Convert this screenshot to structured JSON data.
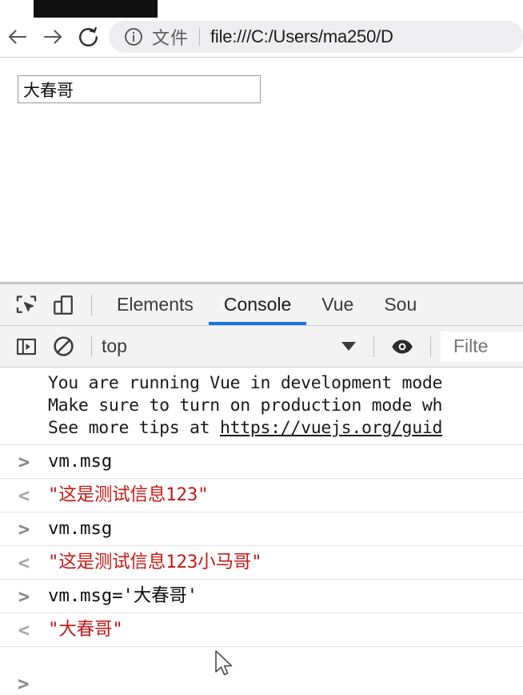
{
  "browser": {
    "nav": {
      "back_label": "Back",
      "forward_label": "Forward",
      "reload_label": "Reload"
    },
    "omnibox": {
      "site_info_icon": "info-circle-icon",
      "scheme_label": "文件",
      "url": "file:///C:/Users/ma250/D"
    }
  },
  "page": {
    "input_value": "大春哥",
    "input_placeholder": ""
  },
  "devtools": {
    "icons": {
      "inspect": "inspect-element-icon",
      "device": "device-toolbar-icon"
    },
    "tabs": [
      {
        "label": "Elements",
        "active": false
      },
      {
        "label": "Console",
        "active": true
      },
      {
        "label": "Vue",
        "active": false
      },
      {
        "label": "Sou",
        "active": false
      }
    ],
    "console_toolbar": {
      "sidebar_icon": "console-sidebar-icon",
      "clear_icon": "clear-console-icon",
      "context": "top",
      "caret_icon": "chevron-down-icon",
      "eye_icon": "live-expression-eye-icon",
      "filter_placeholder": "Filte"
    },
    "messages": {
      "vue_warning": [
        "You are running Vue in development mode",
        "Make sure to turn on production mode wh",
        "See more tips at "
      ],
      "vue_warning_link": "https://vuejs.org/guid"
    },
    "entries": [
      {
        "input_arrow": ">",
        "input": "vm.msg",
        "output_arrow": "<",
        "output": "\"这是测试信息123\""
      },
      {
        "input_arrow": ">",
        "input": "vm.msg",
        "output_arrow": "<",
        "output": "\"这是测试信息123小马哥\""
      },
      {
        "input_arrow": ">",
        "input": "vm.msg='大春哥'",
        "output_arrow": "<",
        "output": "\"大春哥\""
      }
    ],
    "prompt_arrow": ">"
  },
  "colors": {
    "accent_tab_underline": "#1a73e8",
    "string_red": "#c41a16",
    "toolbar_bg": "#f3f3f3",
    "omnibox_bg": "#eeeef0"
  }
}
